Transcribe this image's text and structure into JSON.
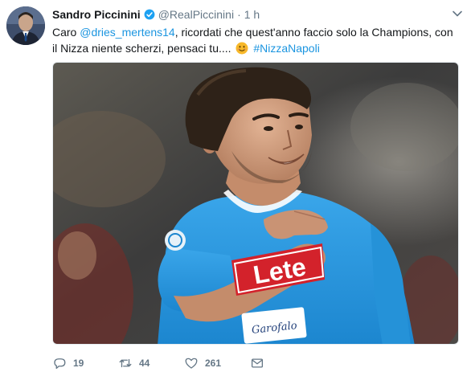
{
  "tweet": {
    "author_name": "Sandro Piccinini",
    "handle": "@RealPiccinini",
    "separator": "·",
    "time": "1 h",
    "text_prefix": "Caro ",
    "mention": "@dries_mertens14",
    "text_middle": ", ricordati che quest'anno faccio solo la Champions, con il Nizza niente scherzi, pensaci tu.... ",
    "hashtag": "#NizzaNapoli",
    "jersey_sponsor": "Lete",
    "jersey_badge": "Garofalo",
    "stats": {
      "replies": "19",
      "retweets": "44",
      "likes": "261"
    }
  },
  "colors": {
    "link": "#1b95e0",
    "muted": "#657786",
    "text": "#14171a",
    "verified": "#1da1f2",
    "jersey": "#2d9be0",
    "sponsor_red": "#d3222b"
  },
  "icons": {
    "verified": "verified-badge-icon",
    "caret": "chevron-down-icon",
    "reply": "reply-icon",
    "retweet": "retweet-icon",
    "like": "heart-icon",
    "dm": "envelope-icon",
    "emoji": "smiling-face-emoji"
  }
}
